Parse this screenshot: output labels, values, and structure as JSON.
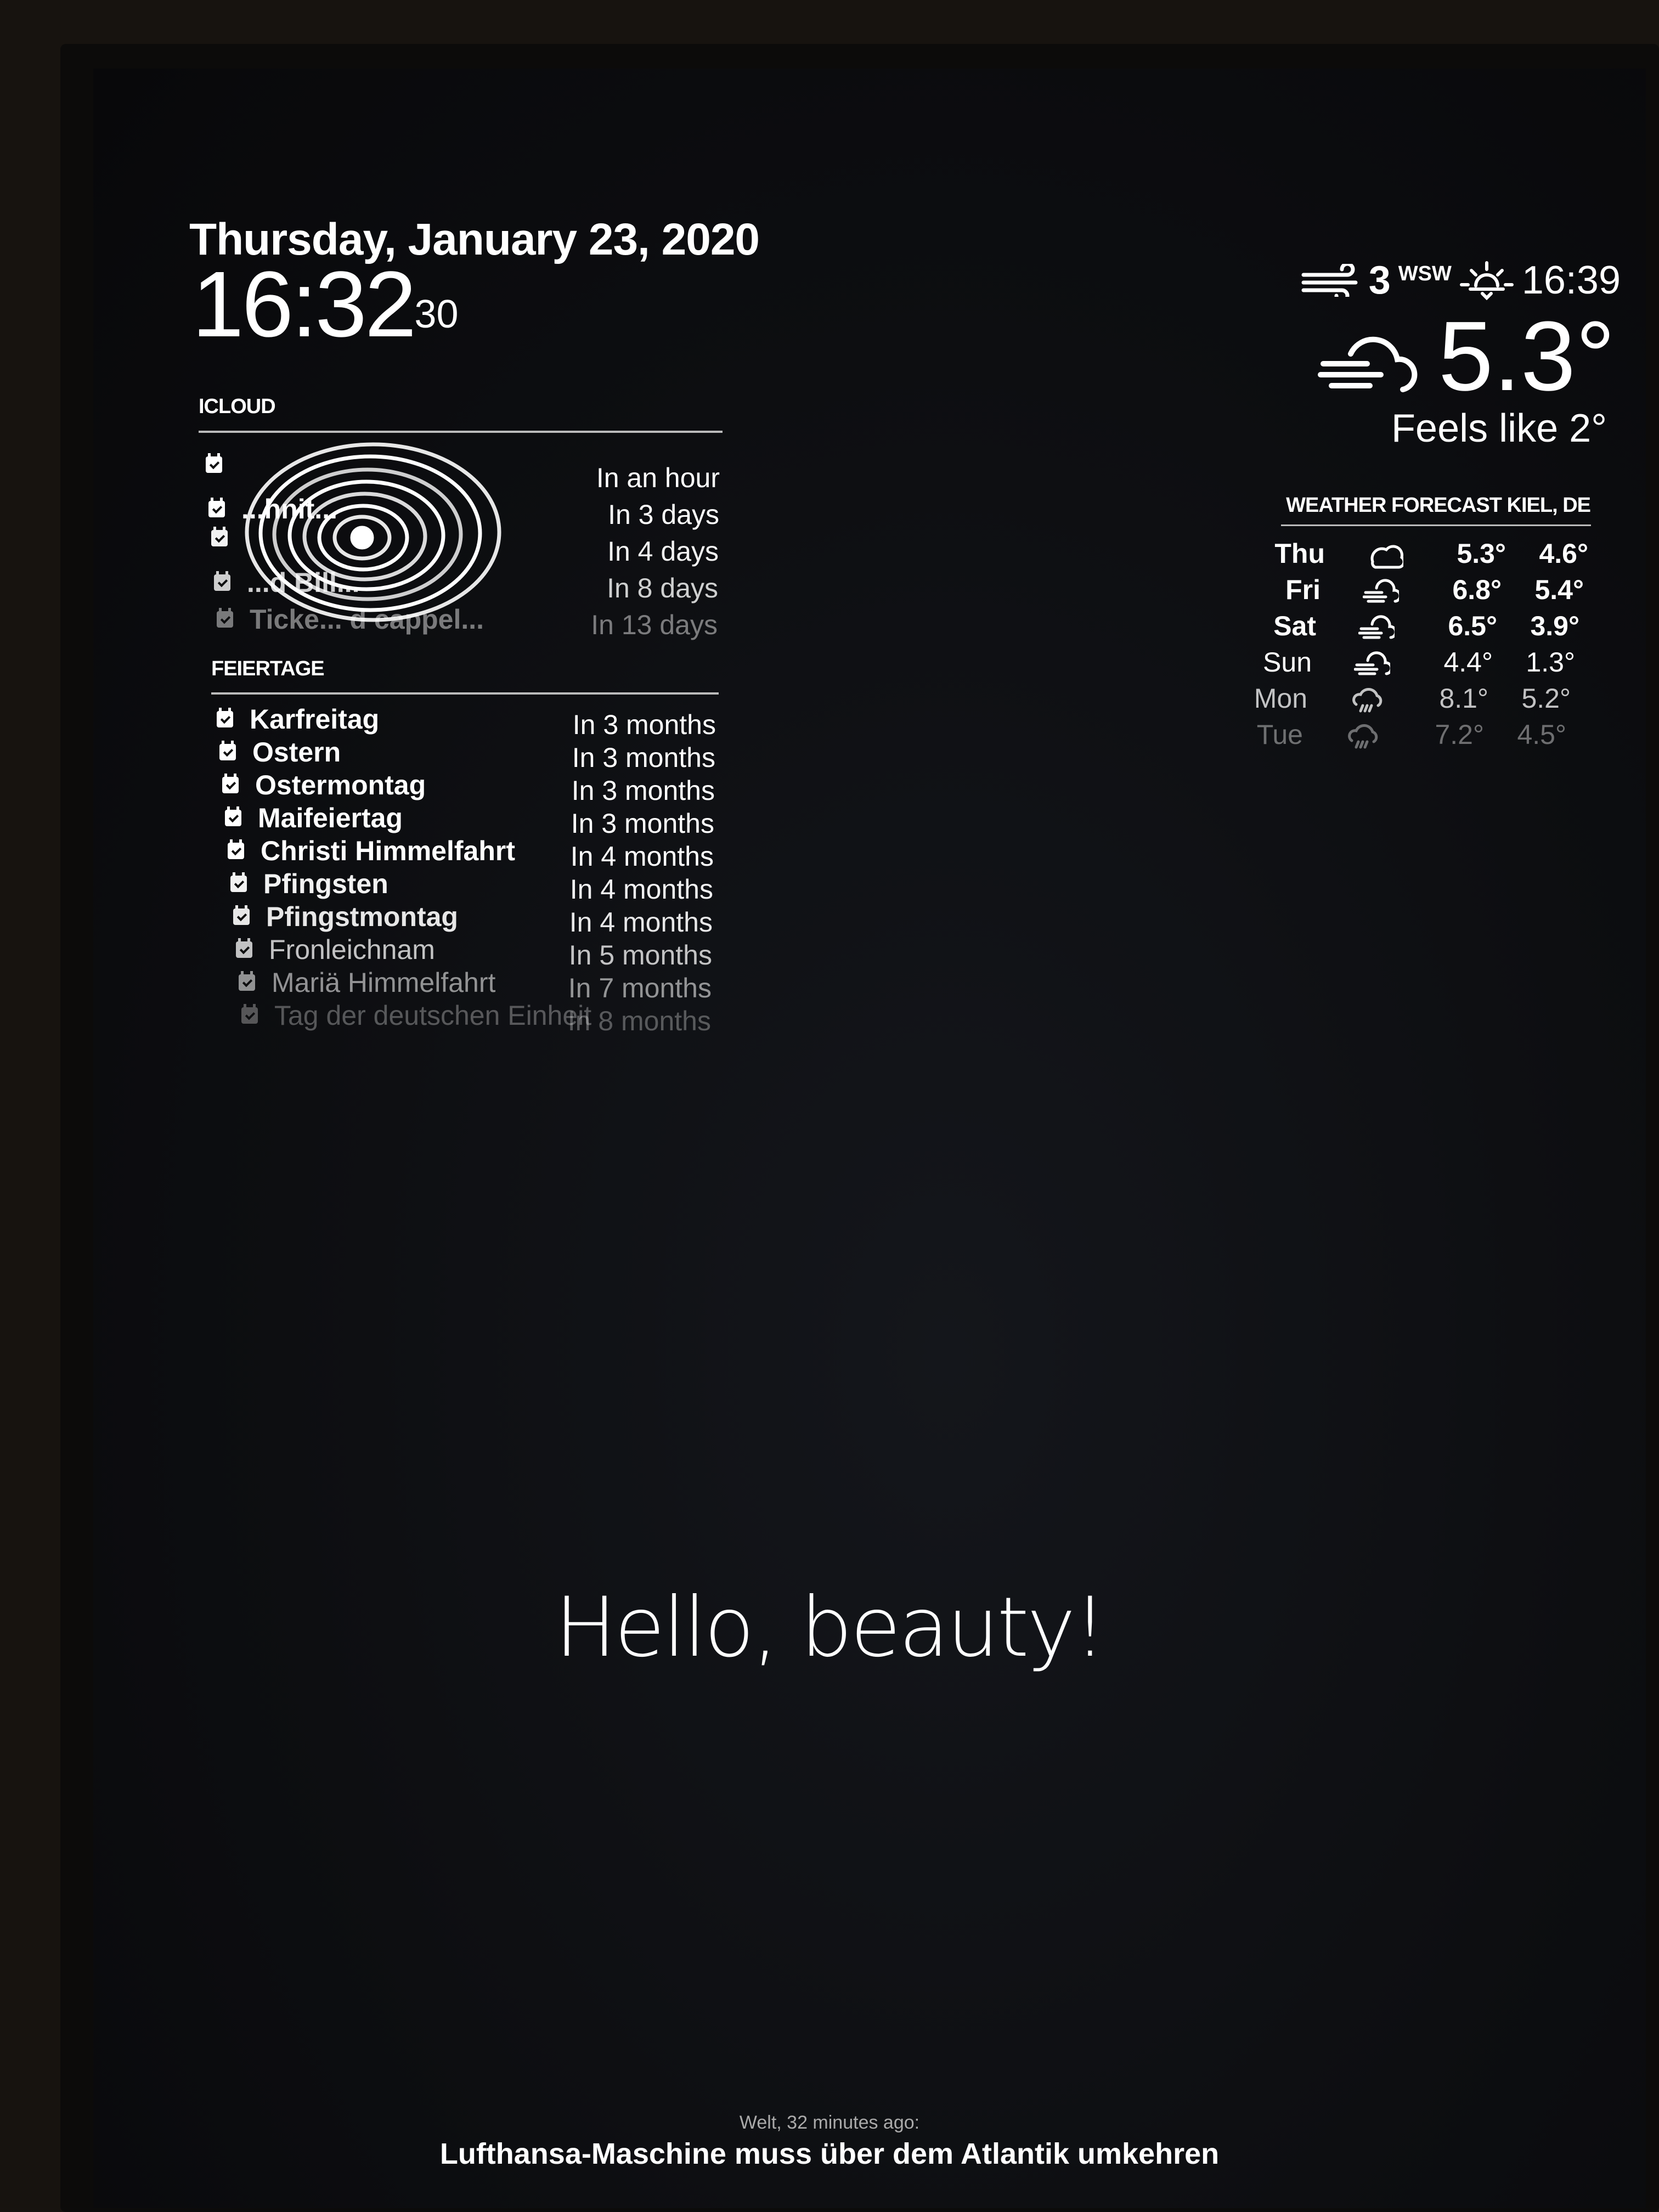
{
  "clock": {
    "date": "Thursday, January 23, 2020",
    "time": "16:32",
    "seconds": "30"
  },
  "icloud": {
    "header": "ICLOUD",
    "events": [
      {
        "title": "",
        "when": "In an hour"
      },
      {
        "title": "...hnit...",
        "when": "In 3 days"
      },
      {
        "title": "",
        "when": "In 4 days"
      },
      {
        "title": "...d Bill...",
        "when": "In 8 days"
      },
      {
        "title": "Ticke... d cappel...",
        "when": "In 13 days"
      }
    ]
  },
  "feiertage": {
    "header": "FEIERTAGE",
    "events": [
      {
        "title": "Karfreitag",
        "when": "In 3 months"
      },
      {
        "title": "Ostern",
        "when": "In 3 months"
      },
      {
        "title": "Ostermontag",
        "when": "In 3 months"
      },
      {
        "title": "Maifeiertag",
        "when": "In 3 months"
      },
      {
        "title": "Christi Himmelfahrt",
        "when": "In 4 months"
      },
      {
        "title": "Pfingsten",
        "when": "In 4 months"
      },
      {
        "title": "Pfingstmontag",
        "when": "In 4 months"
      },
      {
        "title": "Fronleichnam",
        "when": "In 5 months"
      },
      {
        "title": "Mariä Himmelfahrt",
        "when": "In 7 months"
      },
      {
        "title": "Tag der deutschen Einheit",
        "when": "In 8 months"
      }
    ]
  },
  "current_weather": {
    "wind_speed": "3",
    "wind_direction": "WSW",
    "sunset_time": "16:39",
    "temperature": "5.3°",
    "feels_like": "Feels like 2°",
    "icons": {
      "wind": "wind-icon",
      "sunset": "sunset-icon",
      "condition": "cloud-fog-icon"
    }
  },
  "forecast": {
    "header": "WEATHER FORECAST KIEL, DE",
    "days": [
      {
        "day": "Thu",
        "icon": "cloudy-icon",
        "max": "5.3°",
        "min": "4.6°"
      },
      {
        "day": "Fri",
        "icon": "cloud-fog-icon",
        "max": "6.8°",
        "min": "5.4°"
      },
      {
        "day": "Sat",
        "icon": "cloud-fog-icon",
        "max": "6.5°",
        "min": "3.9°"
      },
      {
        "day": "Sun",
        "icon": "cloud-fog-icon",
        "max": "4.4°",
        "min": "1.3°"
      },
      {
        "day": "Mon",
        "icon": "rain-icon",
        "max": "8.1°",
        "min": "5.2°"
      },
      {
        "day": "Tue",
        "icon": "rain-icon",
        "max": "7.2°",
        "min": "4.5°"
      }
    ]
  },
  "compliment": "Hello, beauty!",
  "news": {
    "source": "Welt, 32 minutes ago:",
    "headline": "Lufthansa-Maschine muss über dem Atlantik umkehren"
  }
}
